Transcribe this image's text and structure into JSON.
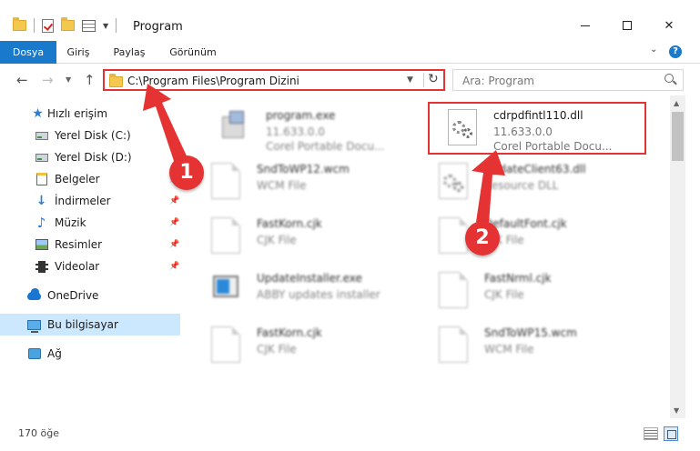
{
  "window": {
    "title": "Program"
  },
  "ribbon": {
    "tabs": [
      {
        "label": "Dosya"
      },
      {
        "label": "Giriş"
      },
      {
        "label": "Paylaş"
      },
      {
        "label": "Görünüm"
      }
    ]
  },
  "address": {
    "path": "C:\\Program Files\\Program Dizini",
    "search_placeholder": "Ara: Program"
  },
  "sidebar": {
    "items": [
      {
        "label": "Hızlı erişim",
        "icon": "star-icon"
      },
      {
        "label": "Yerel Disk (C:)",
        "icon": "disk-icon"
      },
      {
        "label": "Yerel Disk (D:)",
        "icon": "disk-icon"
      },
      {
        "label": "Belgeler",
        "icon": "document-icon"
      },
      {
        "label": "İndirmeler",
        "icon": "download-icon"
      },
      {
        "label": "Müzik",
        "icon": "music-icon"
      },
      {
        "label": "Resimler",
        "icon": "pictures-icon"
      },
      {
        "label": "Videolar",
        "icon": "videos-icon"
      },
      {
        "label": "OneDrive",
        "icon": "onedrive-icon"
      },
      {
        "label": "Bu bilgisayar",
        "icon": "computer-icon"
      },
      {
        "label": "Ağ",
        "icon": "network-icon"
      }
    ]
  },
  "files": [
    {
      "name": "program.exe",
      "line2": "11.633.0.0",
      "line3": "Corel Portable Docu..."
    },
    {
      "name": "cdrpdfintl110.dll",
      "line2": "11.633.0.0",
      "line3": "Corel Portable Docu..."
    },
    {
      "name": "SndToWP12.wcm",
      "line2": "WCM File"
    },
    {
      "name": "UpdateClient63.dll",
      "line2": "Resource DLL"
    },
    {
      "name": "FastKorn.cjk",
      "line2": "CJK File"
    },
    {
      "name": "DefaultFont.cjk",
      "line2": "CJK File"
    },
    {
      "name": "UpdateInstaller.exe",
      "line2": "ABBY updates installer"
    },
    {
      "name": "FastNrml.cjk",
      "line2": "CJK File"
    },
    {
      "name": "FastKorn.cjk",
      "line2": "CJK File"
    },
    {
      "name": "SndToWP15.wcm",
      "line2": "WCM File"
    }
  ],
  "annotations": {
    "badge1": "1",
    "badge2": "2",
    "color": "#e53333"
  },
  "status": {
    "count": "170 öğe"
  }
}
